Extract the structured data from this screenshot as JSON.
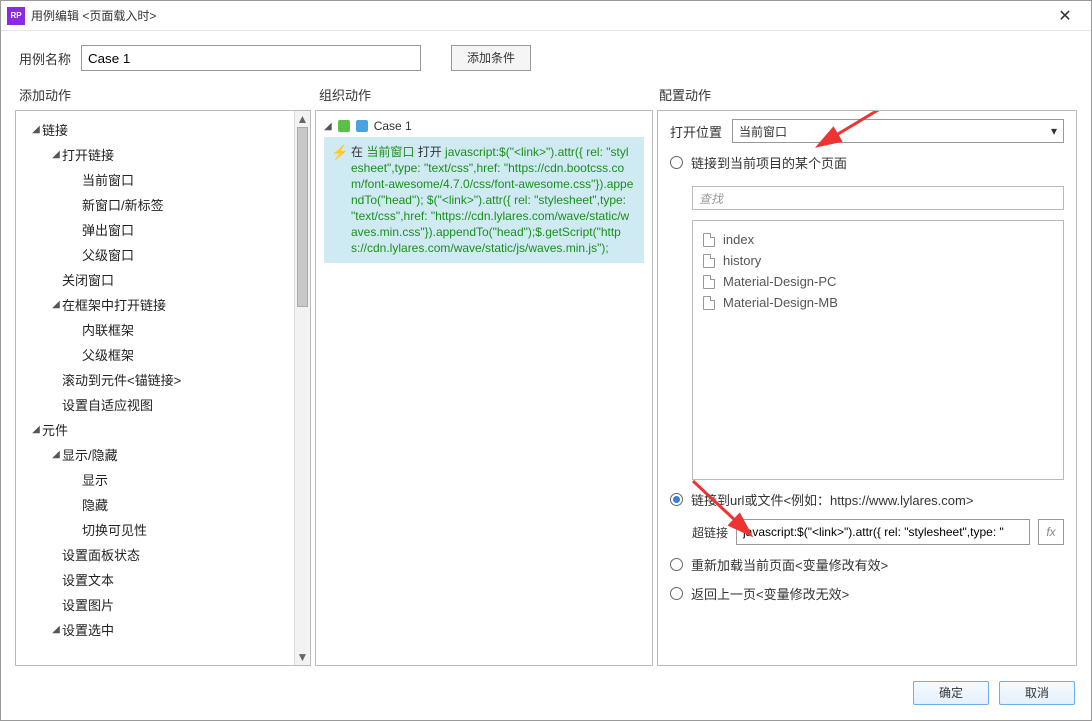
{
  "window": {
    "title": "用例编辑 <页面载入时>"
  },
  "toolbar": {
    "name_label": "用例名称",
    "name_value": "Case 1",
    "add_condition": "添加条件"
  },
  "headings": {
    "left": "添加动作",
    "mid": "组织动作",
    "right": "配置动作"
  },
  "tree": {
    "items": [
      {
        "label": "链接",
        "depth": 0,
        "caret": true
      },
      {
        "label": "打开链接",
        "depth": 1,
        "caret": true
      },
      {
        "label": "当前窗口",
        "depth": 2,
        "caret": false
      },
      {
        "label": "新窗口/新标签",
        "depth": 2,
        "caret": false
      },
      {
        "label": "弹出窗口",
        "depth": 2,
        "caret": false
      },
      {
        "label": "父级窗口",
        "depth": 2,
        "caret": false
      },
      {
        "label": "关闭窗口",
        "depth": 1,
        "caret": false
      },
      {
        "label": "在框架中打开链接",
        "depth": 1,
        "caret": true
      },
      {
        "label": "内联框架",
        "depth": 2,
        "caret": false
      },
      {
        "label": "父级框架",
        "depth": 2,
        "caret": false
      },
      {
        "label": "滚动到元件<锚链接>",
        "depth": 1,
        "caret": false
      },
      {
        "label": "设置自适应视图",
        "depth": 1,
        "caret": false
      },
      {
        "label": "元件",
        "depth": 0,
        "caret": true
      },
      {
        "label": "显示/隐藏",
        "depth": 1,
        "caret": true
      },
      {
        "label": "显示",
        "depth": 2,
        "caret": false
      },
      {
        "label": "隐藏",
        "depth": 2,
        "caret": false
      },
      {
        "label": "切换可见性",
        "depth": 2,
        "caret": false
      },
      {
        "label": "设置面板状态",
        "depth": 1,
        "caret": false
      },
      {
        "label": "设置文本",
        "depth": 1,
        "caret": false
      },
      {
        "label": "设置图片",
        "depth": 1,
        "caret": false
      },
      {
        "label": "设置选中",
        "depth": 1,
        "caret": true
      }
    ]
  },
  "mid": {
    "case_label": "Case 1",
    "action_prefix": "在 ",
    "action_target": "当前窗口",
    "action_open": " 打开  ",
    "action_code": "javascript:$(\"<link>\").attr({ rel: \"stylesheet\",type: \"text/css\",href: \"https://cdn.bootcss.com/font-awesome/4.7.0/css/font-awesome.css\"}).appendTo(\"head\"); $(\"<link>\").attr({ rel: \"stylesheet\",type: \"text/css\",href: \"https://cdn.lylares.com/wave/static/waves.min.css\"}).appendTo(\"head\");$.getScript(\"https://cdn.lylares.com/wave/static/js/waves.min.js\");"
  },
  "right": {
    "open_in_label": "打开位置",
    "open_in_value": "当前窗口",
    "radio_page": "链接到当前项目的某个页面",
    "search_placeholder": "查找",
    "pages": [
      "index",
      "history",
      "Material-Design-PC",
      "Material-Design-MB"
    ],
    "radio_url": "链接到url或文件<例如：https://www.lylares.com>",
    "hyperlink_label": "超链接",
    "hyperlink_value": "javascript:$(\"<link>\").attr({ rel: \"stylesheet\",type: \"",
    "radio_reload": "重新加载当前页面<变量修改有效>",
    "radio_back": "返回上一页<变量修改无效>"
  },
  "footer": {
    "ok": "确定",
    "cancel": "取消"
  }
}
